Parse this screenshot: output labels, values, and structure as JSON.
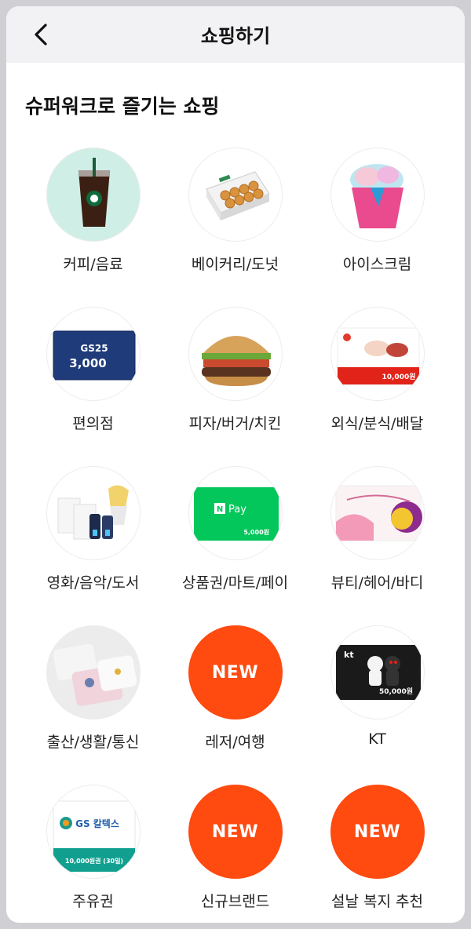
{
  "header": {
    "title": "쇼핑하기",
    "back_icon": "chevron-left-icon"
  },
  "section": {
    "title": "슈퍼워크로 즐기는 쇼핑"
  },
  "colors": {
    "new_badge": "#ff4a10",
    "header_bg": "#f2f2f4"
  },
  "categories": [
    {
      "label": "커피/음료",
      "icon": "iced-coffee-cup-image"
    },
    {
      "label": "베이커리/도넛",
      "icon": "donut-box-image"
    },
    {
      "label": "아이스크림",
      "icon": "ice-cream-cup-image"
    },
    {
      "label": "편의점",
      "icon": "gs25-giftcard-image",
      "card_title": "GS25",
      "card_amount": "3,000"
    },
    {
      "label": "피자/버거/치킨",
      "icon": "burger-image"
    },
    {
      "label": "외식/분식/배달",
      "icon": "food-giftcard-image",
      "card_amount": "10,000원"
    },
    {
      "label": "영화/음악/도서",
      "icon": "movie-ticket-popcorn-image"
    },
    {
      "label": "상품권/마트/페이",
      "icon": "npay-giftcard-image",
      "card_title": "Pay",
      "card_amount": "5,000원"
    },
    {
      "label": "뷰티/헤어/바디",
      "icon": "oliveyoung-giftcard-image"
    },
    {
      "label": "출산/생활/통신",
      "icon": "towels-image"
    },
    {
      "label": "레저/여행",
      "new_text": "NEW"
    },
    {
      "label": "KT",
      "icon": "kt-giftcard-image",
      "card_amount": "50,000원"
    },
    {
      "label": "주유권",
      "icon": "gs-caltex-coupon-image",
      "card_title": "GS 칼텍스",
      "card_amount": "10,000원권 (30일)"
    },
    {
      "label": "신규브랜드",
      "new_text": "NEW"
    },
    {
      "label": "설날 복지 추천",
      "new_text": "NEW"
    }
  ]
}
